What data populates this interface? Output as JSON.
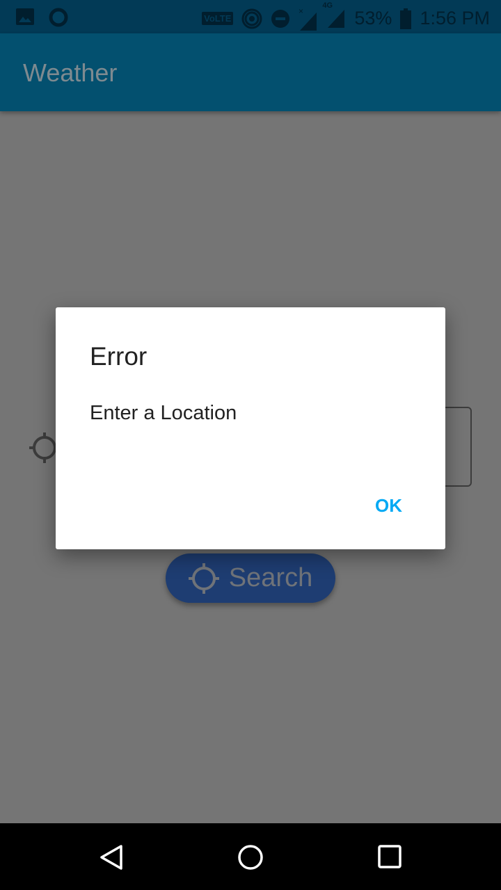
{
  "status_bar": {
    "battery": "53%",
    "time": "1:56 PM",
    "icons": [
      "image-icon",
      "circle-icon",
      "volte-icon",
      "hotspot-icon",
      "dnd-icon",
      "signal-icon",
      "4g-signal-icon",
      "battery-charging-icon"
    ],
    "volte_label": "VoLTE",
    "network_label": "4G"
  },
  "app_bar": {
    "title": "Weather"
  },
  "main": {
    "search_button": "Search"
  },
  "dialog": {
    "title": "Error",
    "message": "Enter a Location",
    "ok_label": "OK",
    "accent": "#03a9f4"
  },
  "nav_bar": {
    "icons": [
      "back-icon",
      "home-icon",
      "recents-icon"
    ]
  }
}
